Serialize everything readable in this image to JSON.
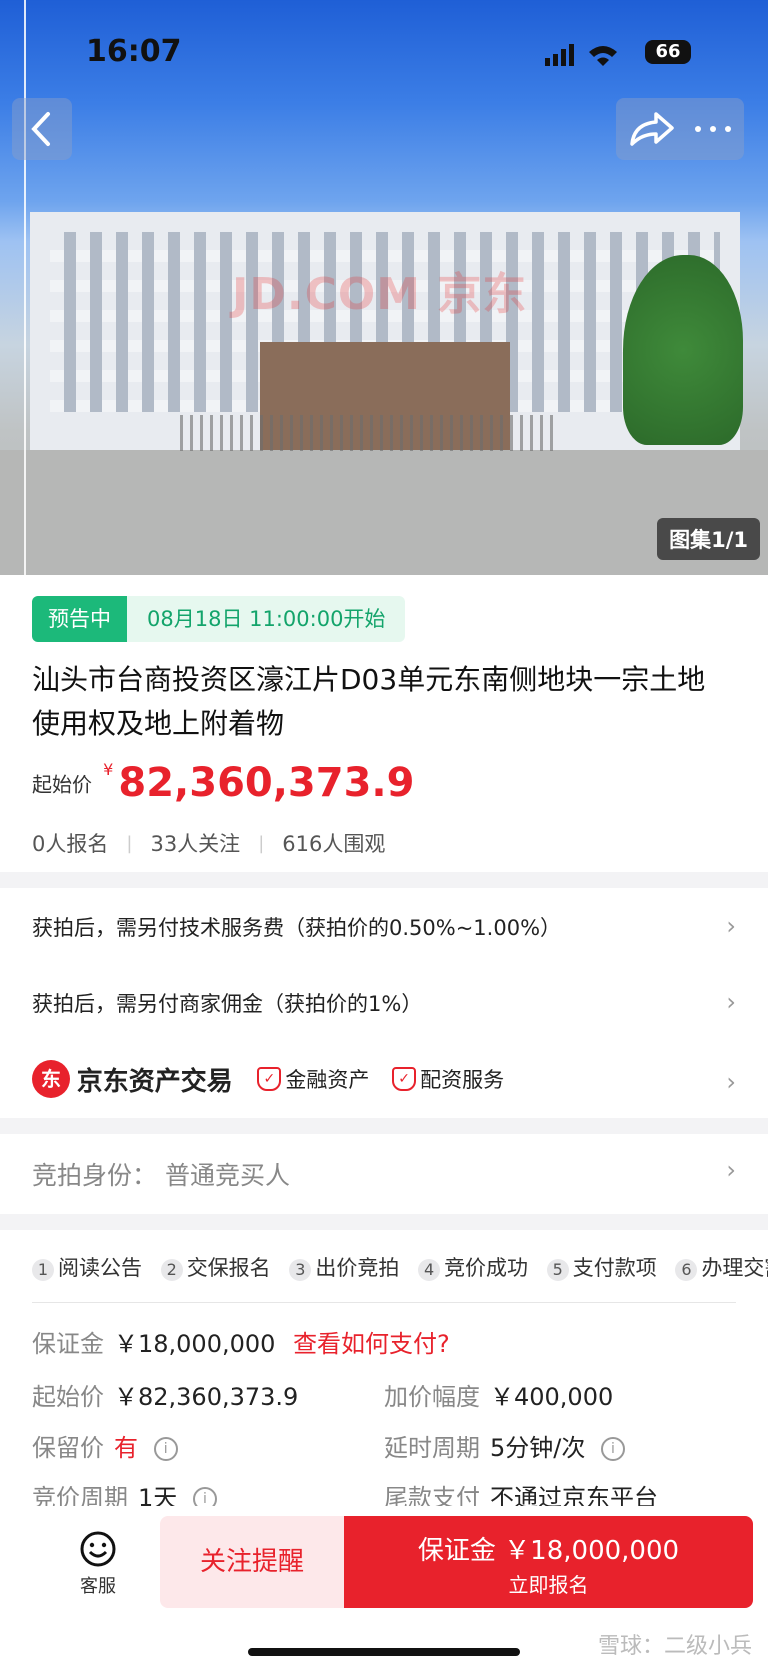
{
  "status_bar": {
    "time": "16:07",
    "battery": "66"
  },
  "hero": {
    "watermark": "JD.COM 京东",
    "gallery": "图集1/1"
  },
  "auction": {
    "badge": "预告中",
    "start_time": "08月18日 11:00:00开始",
    "title": "汕头市台商投资区濠江片D03单元东南侧地块一宗土地使用权及地上附着物",
    "price_label": "起始价",
    "price_currency": "¥",
    "price": "82,360,373.9",
    "stats": [
      "0人报名",
      "33人关注",
      "616人围观"
    ]
  },
  "fees": {
    "row1": "获拍后，需另付技术服务费（获拍价的0.50%~1.00%）",
    "row2": "获拍后，需另付商家佣金（获拍价的1%）"
  },
  "platform": {
    "logo_char": "东",
    "name": "京东资产交易",
    "tag1": "金融资产",
    "tag2": "配资服务"
  },
  "identity": {
    "label": "竞拍身份：",
    "value": "普通竞买人"
  },
  "steps": [
    {
      "num": "1",
      "label": "阅读公告"
    },
    {
      "num": "2",
      "label": "交保报名"
    },
    {
      "num": "3",
      "label": "出价竞拍"
    },
    {
      "num": "4",
      "label": "竞价成功"
    },
    {
      "num": "5",
      "label": "支付款项"
    },
    {
      "num": "6",
      "label": "办理交割"
    }
  ],
  "details": {
    "deposit_k": "保证金",
    "deposit_v": "￥18,000,000",
    "deposit_link": "查看如何支付?",
    "start_k": "起始价",
    "start_v": "￥82,360,373.9",
    "increment_k": "加价幅度",
    "increment_v": "￥400,000",
    "reserve_k": "保留价",
    "reserve_v": "有",
    "delay_k": "延时周期",
    "delay_v": "5分钟/次",
    "cycle_k": "竞价周期",
    "cycle_v": "1天",
    "payment_k": "尾款支付",
    "payment_v": "不通过京东平台"
  },
  "bottom_bar": {
    "service": "客服",
    "follow": "关注提醒",
    "enroll_main": "保证金 ￥18,000,000",
    "enroll_sub": "立即报名"
  },
  "watermark_footer": "雪球：二级小兵",
  "colors": {
    "accent_red": "#e8222c",
    "green": "#1cb97a"
  }
}
